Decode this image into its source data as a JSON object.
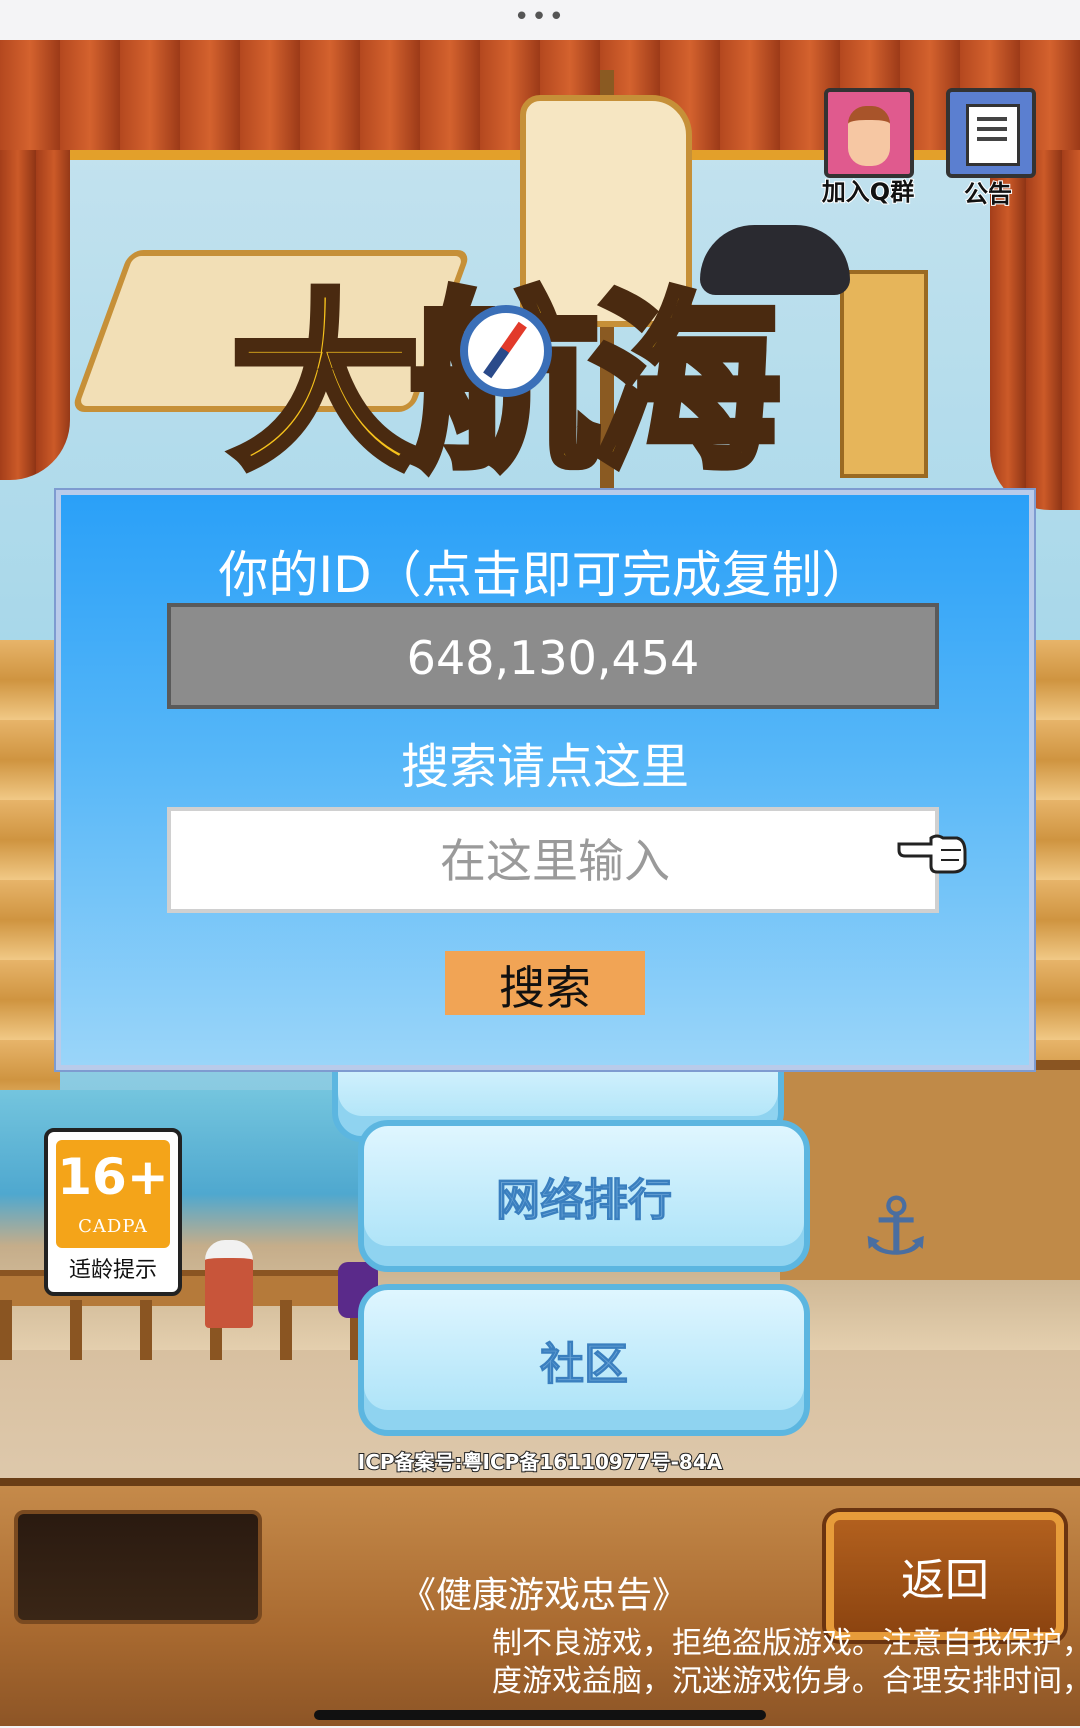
{
  "status_bar": {
    "more_glyph": "•••"
  },
  "top_icons": {
    "qq": {
      "label": "加入Q群",
      "icon": "character-portrait-icon"
    },
    "announcement": {
      "label": "公告",
      "icon": "document-icon"
    }
  },
  "logo": {
    "text": "大航海"
  },
  "dialog": {
    "id_title": "你的ID（点击即可完成复制）",
    "id_value": "648,130,454",
    "search_title": "搜索请点这里",
    "search_placeholder": "在这里输入",
    "search_button": "搜索"
  },
  "menu": {
    "ranking": "网络排行",
    "community": "社区"
  },
  "age_rating": {
    "age": "16+",
    "org": "CADPA",
    "tip": "适龄提示"
  },
  "icp": "ICP备案号:粤ICP备16110977号-84A",
  "bottom": {
    "back_button": "返回",
    "health_title": "《健康游戏忠告》",
    "health_line1": "制不良游戏，拒绝盗版游戏。注意自我保护，",
    "health_line2": "度游戏益脑，沉迷游戏伤身。合理安排时间，"
  },
  "colors": {
    "dialog_top": "#2aa0f8",
    "dialog_bottom": "#9ad5f9",
    "id_box": "#8c8c8c",
    "search_button": "#f1a455",
    "back_border": "#e79c3a",
    "age_badge": "#f4a419"
  }
}
